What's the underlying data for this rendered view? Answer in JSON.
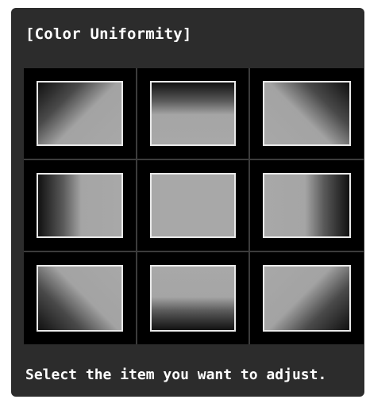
{
  "panel": {
    "title": "[Color Uniformity]",
    "help_text": "Select the item you want to adjust."
  },
  "grid": {
    "items": [
      {
        "name": "upper-left",
        "gradient_direction": "dark at top-left corner"
      },
      {
        "name": "top",
        "gradient_direction": "dark at top edge"
      },
      {
        "name": "upper-right",
        "gradient_direction": "dark at top-right corner"
      },
      {
        "name": "left",
        "gradient_direction": "dark at left edge"
      },
      {
        "name": "center",
        "gradient_direction": "uniform"
      },
      {
        "name": "right",
        "gradient_direction": "dark at right edge"
      },
      {
        "name": "lower-left",
        "gradient_direction": "dark at bottom-left corner"
      },
      {
        "name": "bottom",
        "gradient_direction": "dark at bottom edge"
      },
      {
        "name": "lower-right",
        "gradient_direction": "dark at bottom-right corner"
      }
    ]
  },
  "colors": {
    "panel_background": "#2c2c2c",
    "grid_background": "#000000",
    "thumbnail_border": "#e9e9e9",
    "thumbnail_fill": "#a8a8a8",
    "text": "#ffffff"
  }
}
